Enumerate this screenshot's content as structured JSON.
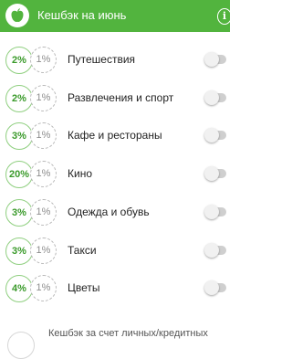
{
  "header": {
    "title": "Кешбэк на июнь",
    "app_icon": "apple-icon",
    "info_glyph": "i",
    "background": "#52b43e"
  },
  "categories": [
    {
      "main": "2%",
      "base": "1%",
      "label": "Путешествия",
      "enabled": false
    },
    {
      "main": "2%",
      "base": "1%",
      "label": "Развлечения и спорт",
      "enabled": false
    },
    {
      "main": "3%",
      "base": "1%",
      "label": "Кафе и рестораны",
      "enabled": false
    },
    {
      "main": "20%",
      "base": "1%",
      "label": "Кино",
      "enabled": false
    },
    {
      "main": "3%",
      "base": "1%",
      "label": "Одежда и обувь",
      "enabled": false
    },
    {
      "main": "3%",
      "base": "1%",
      "label": "Такси",
      "enabled": false
    },
    {
      "main": "4%",
      "base": "1%",
      "label": "Цветы",
      "enabled": false
    }
  ],
  "footer": {
    "text": "Кешбэк за счет личных/кредитных"
  }
}
